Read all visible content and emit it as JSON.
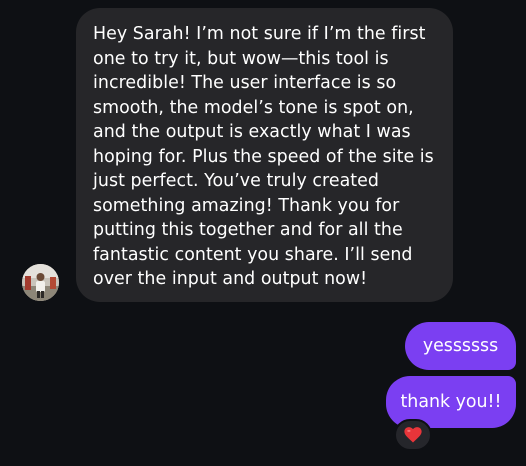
{
  "colors": {
    "background": "#0e1014",
    "incoming_bubble": "#262629",
    "outgoing_bubble": "#7b3ff2",
    "reaction_heart": "#e8353a"
  },
  "incoming": {
    "sender_avatar_icon": "profile-photo",
    "lines": [
      "Hey Sarah! I’m not sure if I’m the first",
      "one to try it, but wow—this tool is",
      "incredible! The user interface is so",
      "smooth, the model’s tone is spot on,",
      "and the output is exactly what I was",
      "hoping for. Plus the speed of the site is",
      "just perfect. You’ve truly created",
      "something amazing! Thank you for",
      "putting this together and for all the",
      "fantastic content you share. I’ll send",
      "over the input and output now!"
    ]
  },
  "outgoing": [
    {
      "text": "yessssss"
    },
    {
      "text": "thank you!!",
      "reaction": "❤️",
      "reaction_icon": "red-heart"
    }
  ]
}
